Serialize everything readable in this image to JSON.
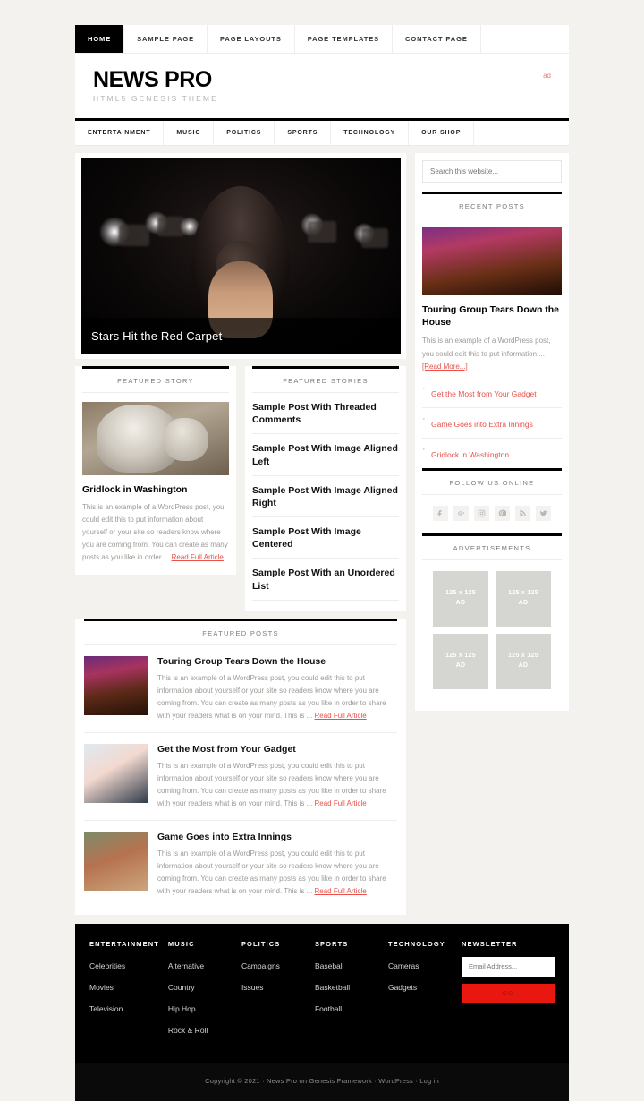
{
  "top_nav": [
    {
      "label": "HOME",
      "active": true
    },
    {
      "label": "SAMPLE PAGE",
      "active": false
    },
    {
      "label": "PAGE LAYOUTS",
      "active": false
    },
    {
      "label": "PAGE TEMPLATES",
      "active": false
    },
    {
      "label": "CONTACT PAGE",
      "active": false
    }
  ],
  "header": {
    "logo": "NEWS PRO",
    "tagline": "HTML5 GENESIS THEME",
    "ad_label": "ad"
  },
  "sub_nav": [
    {
      "label": "ENTERTAINMENT"
    },
    {
      "label": "MUSIC"
    },
    {
      "label": "POLITICS"
    },
    {
      "label": "SPORTS"
    },
    {
      "label": "TECHNOLOGY"
    },
    {
      "label": "OUR SHOP"
    }
  ],
  "hero": {
    "caption": "Stars Hit the Red Carpet"
  },
  "featured_story": {
    "widget_title": "FEATURED STORY",
    "title": "Gridlock in Washington",
    "excerpt": "This is an example of a WordPress post, you could edit this to put information about yourself or your site so readers know where you are coming from. You can create as many posts as you like in order ... ",
    "read_more": "Read Full Article"
  },
  "featured_stories": {
    "widget_title": "FEATURED STORIES",
    "items": [
      "Sample Post With Threaded Comments",
      "Sample Post With Image Aligned Left",
      "Sample Post With Image Aligned Right",
      "Sample Post With Image Centered",
      "Sample Post With an Unordered List"
    ]
  },
  "featured_posts": {
    "widget_title": "FEATURED POSTS",
    "items": [
      {
        "title": "Touring Group Tears Down the House",
        "excerpt": "This is an example of a WordPress post, you could edit this to put information about yourself or your site so readers know where you are coming from. You can create as many posts as you like in order to share with your readers what is on your mind. This is ... ",
        "read_more": "Read Full Article",
        "thumb": "concert-thumbnail"
      },
      {
        "title": "Get the Most from Your Gadget",
        "excerpt": "This is an example of a WordPress post, you could edit this to put information about yourself or your site so readers know where you are coming from. You can create as many posts as you like in order to share with your readers what is on your mind. This is ... ",
        "read_more": "Read Full Article",
        "thumb": "gadget-thumbnail"
      },
      {
        "title": "Game Goes into Extra Innings",
        "excerpt": "This is an example of a WordPress post, you could edit this to put information about yourself or your site so readers know where you are coming from. You can create as many posts as you like in order to share with your readers what is on your mind. This is ... ",
        "read_more": "Read Full Article",
        "thumb": "baseball-thumbnail"
      }
    ]
  },
  "sidebar": {
    "search_placeholder": "Search this website...",
    "recent_posts": {
      "widget_title": "RECENT POSTS",
      "feature": {
        "title": "Touring Group Tears Down the House",
        "excerpt": "This is an example of a WordPress post, you could edit this to put information ... ",
        "read_more": "[Read More...]"
      },
      "links": [
        "Get the Most from Your Gadget",
        "Game Goes into Extra Innings",
        "Gridlock in Washington"
      ]
    },
    "follow": {
      "widget_title": "FOLLOW US ONLINE",
      "icons": [
        "facebook-icon",
        "google-plus-icon",
        "instagram-icon",
        "pinterest-icon",
        "rss-icon",
        "twitter-icon"
      ]
    },
    "ads": {
      "widget_title": "ADVERTISEMENTS",
      "boxes": [
        {
          "size": "125 x 125",
          "label": "AD"
        },
        {
          "size": "125 x 125",
          "label": "AD"
        },
        {
          "size": "125 x 125",
          "label": "AD"
        },
        {
          "size": "125 x 125",
          "label": "AD"
        }
      ]
    }
  },
  "footer_widgets": [
    {
      "heading": "ENTERTAINMENT",
      "links": [
        "Celebrities",
        "Movies",
        "Television"
      ]
    },
    {
      "heading": "MUSIC",
      "links": [
        "Alternative",
        "Country",
        "Hip Hop",
        "Rock & Roll"
      ]
    },
    {
      "heading": "POLITICS",
      "links": [
        "Campaigns",
        "Issues"
      ]
    },
    {
      "heading": "SPORTS",
      "links": [
        "Baseball",
        "Basketball",
        "Football"
      ]
    },
    {
      "heading": "TECHNOLOGY",
      "links": [
        "Cameras",
        "Gadgets"
      ]
    }
  ],
  "newsletter": {
    "heading": "NEWSLETTER",
    "placeholder": "Email Address...",
    "button": "GO"
  },
  "credits": {
    "text": "Copyright © 2021 · News Pro on Genesis Framework · WordPress · Log in"
  },
  "colors": {
    "accent_red": "#e8504a",
    "button_red": "#e8170f",
    "black": "#000000",
    "page_bg": "#f4f2ef"
  }
}
